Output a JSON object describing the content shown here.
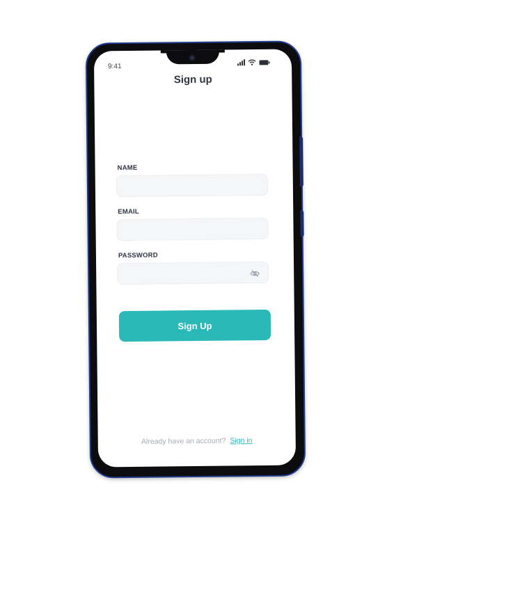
{
  "status_bar": {
    "time": "9:41",
    "icons": [
      "signal-icon",
      "wifi-icon",
      "battery-icon"
    ]
  },
  "header": {
    "title": "Sign up"
  },
  "form": {
    "name_label": "NAME",
    "name_value": "",
    "email_label": "EMAIL",
    "email_value": "",
    "password_label": "PASSWORD",
    "password_value": "",
    "password_toggle_icon": "eye-slash-icon"
  },
  "actions": {
    "submit_label": "Sign Up"
  },
  "footer": {
    "prompt": "Already have an account?",
    "signin_label": "Sign in"
  },
  "colors": {
    "accent": "#2bb9b8",
    "title_text": "#2f3542",
    "field_bg": "#f5f6f8",
    "muted_text": "#a7adb6",
    "phone_frame": "#0c0c0e",
    "phone_edge": "#1f3c8f"
  }
}
